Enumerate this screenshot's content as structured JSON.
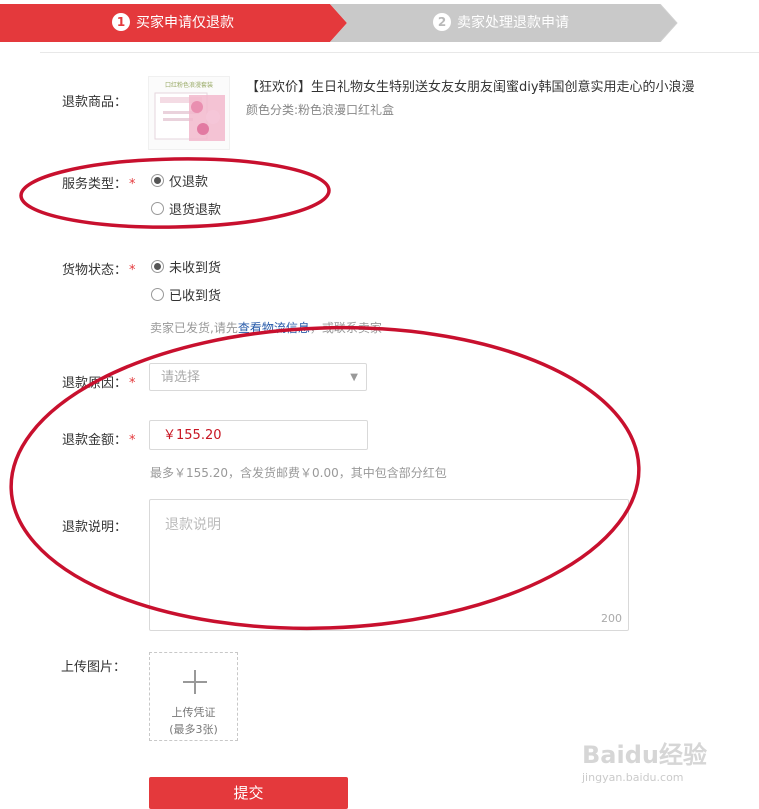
{
  "steps": [
    {
      "num": "1",
      "label": "买家申请仅退款"
    },
    {
      "num": "2",
      "label": "卖家处理退款申请"
    }
  ],
  "form": {
    "product": {
      "label": "退款商品：",
      "title": "【狂欢价】生日礼物女生特别送女友女朋友闺蜜diy韩国创意实用走心的小浪漫",
      "spec": "颜色分类:粉色浪漫口红礼盒",
      "image_text": "口红粉色浪漫套装"
    },
    "service_type": {
      "label": "服务类型：",
      "required": "*",
      "options": [
        "仅退款",
        "退货退款"
      ],
      "selected": "仅退款"
    },
    "goods_status": {
      "label": "货物状态：",
      "required": "*",
      "options": [
        "未收到货",
        "已收到货"
      ],
      "selected": "未收到货",
      "hint_prefix": "卖家已发货,请先",
      "hint_link": "查看物流信息",
      "hint_suffix": "，或联系卖家"
    },
    "reason": {
      "label": "退款原因：",
      "required": "*",
      "placeholder": "请选择"
    },
    "amount": {
      "label": "退款金额：",
      "required": "*",
      "value": "￥155.20",
      "hint": "最多￥155.20，含发货邮费￥0.00，其中包含部分红包"
    },
    "description": {
      "label": "退款说明：",
      "placeholder": "退款说明",
      "max_chars": "200"
    },
    "upload": {
      "label": "上传图片：",
      "text": "上传凭证",
      "subtext": "(最多3张)"
    },
    "submit_label": "提交"
  },
  "watermark": {
    "brand": "Baidu经验",
    "url": "jingyan.baidu.com"
  },
  "colors": {
    "accent": "#e4393c",
    "step_inactive": "#c9c9c9",
    "annotation": "#c8102e"
  }
}
